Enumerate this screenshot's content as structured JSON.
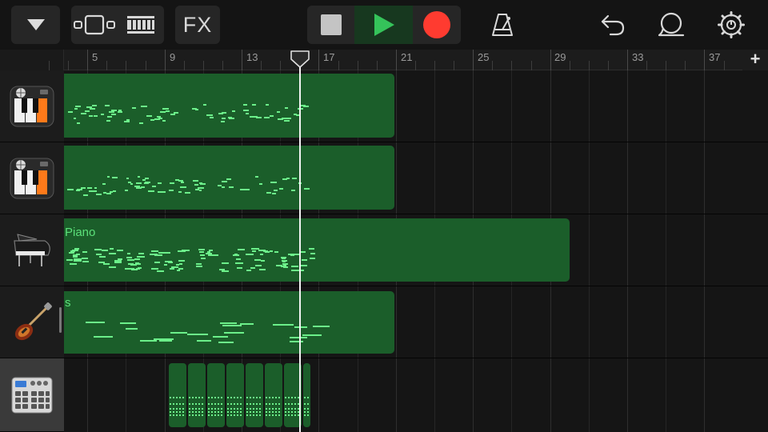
{
  "toolbar": {
    "fx_label": "FX",
    "icons": {
      "browser": "triangle-down-icon",
      "view": "tracks-view-icon",
      "mixer": "mixer-icon",
      "stop": "stop-icon",
      "play": "play-icon",
      "record": "record-icon",
      "metronome": "metronome-icon",
      "undo": "undo-icon",
      "loop": "loop-icon",
      "settings": "gear-icon"
    },
    "colors": {
      "play": "#35c35a",
      "record": "#ff3b30"
    }
  },
  "ruler": {
    "bar_labels": [
      "5",
      "9",
      "13",
      "17",
      "21",
      "25",
      "29",
      "33",
      "37"
    ],
    "add_track_label": "+"
  },
  "tracks": [
    {
      "instrument": "keyboard-instrument-icon",
      "region_title": ""
    },
    {
      "instrument": "keyboard-instrument-icon",
      "region_title": ""
    },
    {
      "instrument": "grand-piano-icon",
      "region_title": "Piano"
    },
    {
      "instrument": "bass-guitar-icon",
      "region_title": "s"
    },
    {
      "instrument": "drum-machine-icon",
      "region_title": ""
    }
  ],
  "colors": {
    "region": "#1b5e2a",
    "note": "#6cf08a",
    "region_title": "#5ce07a"
  }
}
